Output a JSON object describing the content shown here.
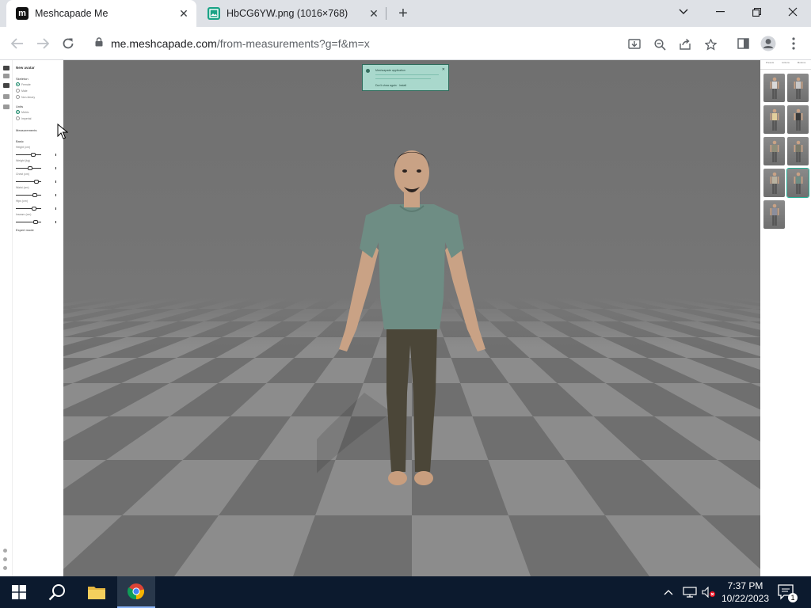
{
  "browser": {
    "tabs": [
      {
        "title": "Meshcapade Me",
        "active": true,
        "favicon": "meshcapade-logo-icon"
      },
      {
        "title": "HbCG6YW.png (1016×768)",
        "active": false,
        "favicon": "image-file-icon"
      }
    ],
    "url_host": "me.meshcapade.com",
    "url_path": "/from-measurements?g=f&m=x"
  },
  "left_panel": {
    "title": "New avatar",
    "skeleton_label": "Skeleton",
    "skeleton_options": [
      "Female",
      "Male",
      "Non-binary"
    ],
    "unit_label": "Units",
    "unit_options": [
      "Metric",
      "Imperial"
    ],
    "measurements_label": "Measurements",
    "basic_label": "Basic",
    "sliders": [
      {
        "label": "Height (cm)",
        "value": 0.7
      },
      {
        "label": "Weight (kg)",
        "value": 0.55
      },
      {
        "label": "Chest (cm)",
        "value": 0.8
      },
      {
        "label": "Waist (cm)",
        "value": 0.75
      },
      {
        "label": "Hips (cm)",
        "value": 0.72
      },
      {
        "label": "Inseam (cm)",
        "value": 0.78
      }
    ],
    "expert_label": "Expert mode"
  },
  "toast": {
    "title": "Meshcapade application",
    "link": "Don't show again  ·  Install"
  },
  "right_panel": {
    "tabs": [
      "Presets",
      "Actions",
      "Motions"
    ],
    "thumbnails": 9,
    "selected_index": 7
  },
  "taskbar": {
    "time": "7:37 PM",
    "date": "10/22/2023",
    "notification_count": "1"
  },
  "colors": {
    "accent": "#1d8a6b",
    "viewport_bg": "#717171",
    "taskbar_bg": "#0c1a2e"
  }
}
